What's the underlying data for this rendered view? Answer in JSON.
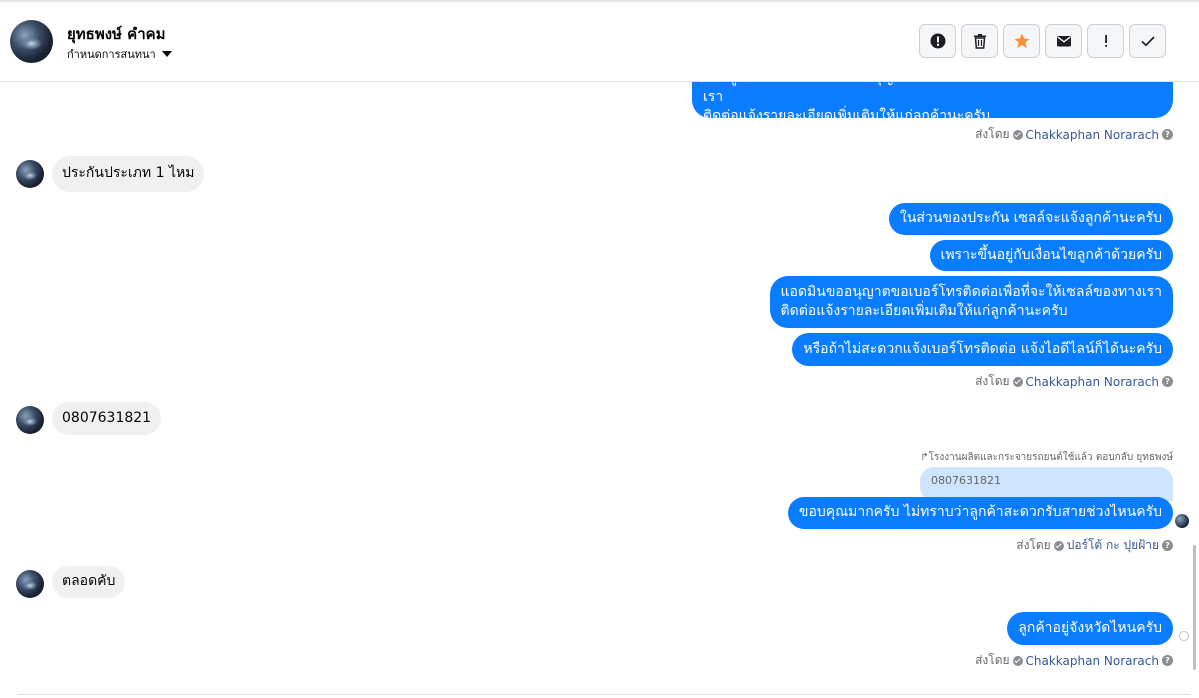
{
  "header": {
    "contact_name": "ยุทธพงษ์ คำคม",
    "subtitle": "กำหนดการสนทนา"
  },
  "actions": [
    {
      "name": "spam-icon"
    },
    {
      "name": "trash-icon"
    },
    {
      "name": "star-icon",
      "color": "#f7923a"
    },
    {
      "name": "mail-icon"
    },
    {
      "name": "exclamation-icon"
    },
    {
      "name": "check-icon"
    }
  ],
  "messages": {
    "top_partial_line1": "หากลูกค้าสนใจ แอดมินขออนุญาตขอเบอร์โทรติดต่อเพื่อที่จะให้เซลล์ของทางเรา",
    "top_partial_line2": "ติดต่อแจ้งรายละเอียดเพิ่มเติมให้แก่ลูกค้านะครับ",
    "sent_by_1": "ส่งโดย",
    "agent_1": "Chakkaphan Norarach",
    "in_1": "ประกันประเภท 1 ไหม",
    "out_1": "ในส่วนของประกัน เซลล์จะแจ้งลูกค้านะครับ",
    "out_2": "เพราะขึ้นอยู่กับเงื่อนไขลูกค้าด้วยครับ",
    "out_3_line1": "แอดมินขออนุญาตขอเบอร์โทรติดต่อเพื่อที่จะให้เซลล์ของทางเรา",
    "out_3_line2": "ติดต่อแจ้งรายละเอียดเพิ่มเติมให้แก่ลูกค้านะครับ",
    "out_4": "หรือถ้าไม่สะดวกแจ้งเบอร์โทรติดต่อ แจ้งไอดีไลน์ก็ได้นะครับ",
    "sent_by_2": "ส่งโดย",
    "agent_2": "Chakkaphan Norarach",
    "in_2": "0807631821",
    "reply_note": "↱โรงงานผลิตและกระจายรถยนต์ใช้แล้ว ตอบกลับ ยุทธพงษ์",
    "reply_quote": "0807631821",
    "out_5": "ขอบคุณมากครับ ไม่ทราบว่าลูกค้าสะดวกรับสายช่วงไหนครับ",
    "sent_by_3": "ส่งโดย",
    "agent_3": "ปอร์โต้ กะ ปุยฝ้าย",
    "in_3": "ตลอดคับ",
    "out_6": "ลูกค้าอยู่จังหวัดไหนครับ",
    "sent_by_4": "ส่งโดย",
    "agent_4": "Chakkaphan Norarach"
  }
}
